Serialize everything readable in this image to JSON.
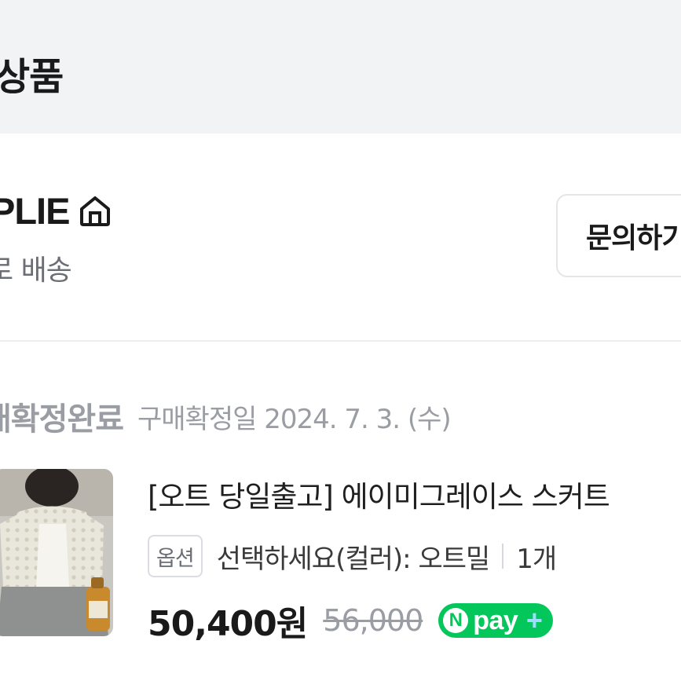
{
  "header": {
    "title": "상품"
  },
  "store": {
    "name": "PLIE",
    "name_icon": "home-icon",
    "delivery": "로 배송",
    "inquiry_label": "문의하기"
  },
  "order": {
    "status": "매확정완료",
    "confirm_date": "구매확정일 2024. 7. 3. (수)"
  },
  "product": {
    "title": "[오트 당일출고] 에이미그레이스 스커트",
    "option_badge": "옵션",
    "option_text": "선택하세요(컬러): 오트밀",
    "quantity": "1개",
    "sale_price": "50,400원",
    "original_price": "56,000",
    "payment_badge": {
      "n_letter": "N",
      "label": "pay",
      "plus": "+",
      "brand_color": "#03c75a"
    }
  },
  "colors": {
    "band_background": "#f2f3f5",
    "muted_text": "#9a9da3",
    "border": "#e3e5e8"
  }
}
